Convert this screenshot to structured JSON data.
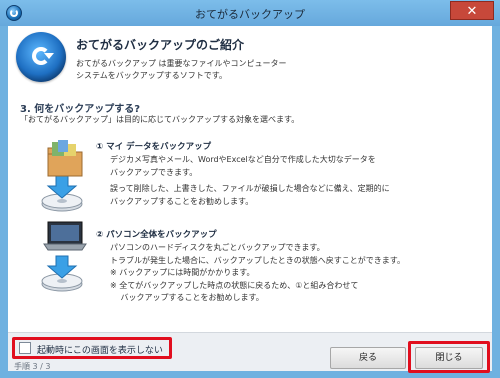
{
  "window": {
    "title": "おてがるバックアップ",
    "close_glyph": "✕"
  },
  "header": {
    "title": "おてがるバックアップのご紹介",
    "intro_lines": [
      "おてがるバックアップ は重要なファイルやコンピューター",
      "システムをバックアップするソフトです。"
    ]
  },
  "section": {
    "title": "3. 何をバックアップする?",
    "subtitle": "「おてがるバックアップ」は目的に応じてバックアップする対象を選べます。"
  },
  "items": [
    {
      "title": "① マイ データをバックアップ",
      "icon": "folder-disc-icon",
      "lines": [
        "デジカメ写真やメール、WordやExcelなど自分で作成した大切なデータを",
        "バックアップできます。",
        "誤って削除した、上書きした、ファイルが破損した場合などに備え、定期的に",
        "バックアップすることをお勧めします。"
      ]
    },
    {
      "title": "② パソコン全体をバックアップ",
      "icon": "laptop-disc-icon",
      "lines": [
        "パソコンのハードディスクを丸ごとバックアップできます。",
        "トラブルが発生した場合に、バックアップしたときの状態へ戻すことができます。",
        "※ バックアップには時間がかかります。",
        "※ 全てがバックアップした時点の状態に戻るため、①と組み合わせて",
        "　 バックアップすることをお勧めします。"
      ]
    }
  ],
  "footer": {
    "checkbox_label": "起動時にこの画面を表示しない",
    "checkbox_checked": false,
    "step": "手順 3 / 3",
    "back_label": "戻る",
    "close_label": "閉じる"
  },
  "colors": {
    "titlebar": "#6fb1e0",
    "close": "#c7483a",
    "highlight": "#e10e1e"
  }
}
